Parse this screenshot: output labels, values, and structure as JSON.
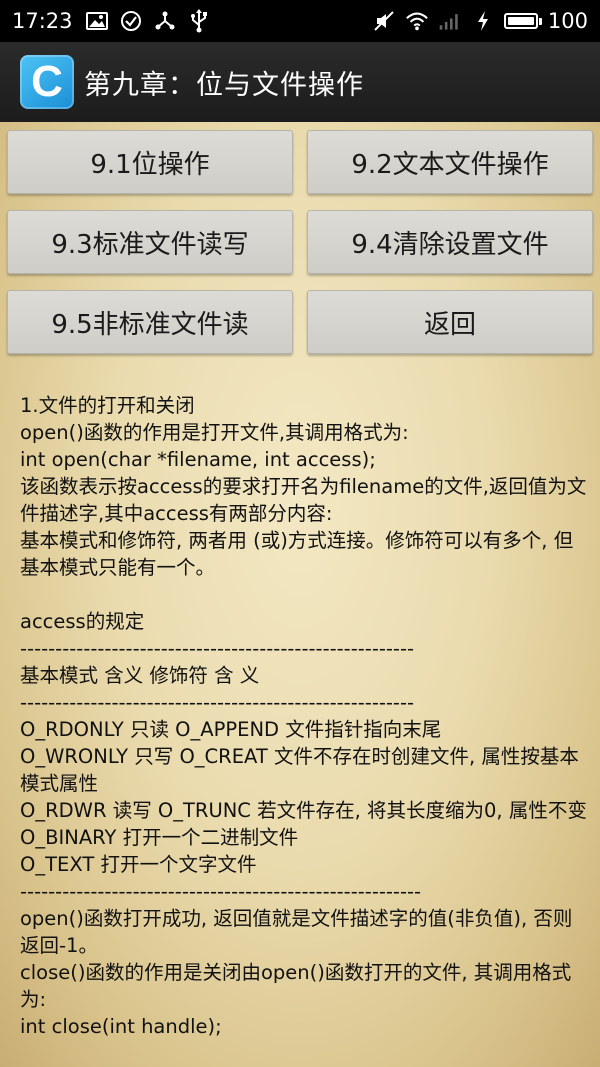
{
  "status_bar": {
    "time": "17:23",
    "battery_level": "100",
    "battery_fraction": 1.0,
    "left_icons": [
      "image-icon",
      "check-circle-icon",
      "share-nodes-icon",
      "usb-icon"
    ],
    "right_icons": [
      "mute-icon",
      "wifi-icon",
      "signal-icon",
      "charging-icon"
    ]
  },
  "app_bar": {
    "logo_letter": "C",
    "title": "第九章：位与文件操作"
  },
  "buttons": [
    {
      "label": "9.1位操作"
    },
    {
      "label": "9.2文本文件操作"
    },
    {
      "label": "9.3标准文件读写"
    },
    {
      "label": "9.4清除设置文件"
    },
    {
      "label": "9.5非标准文件读"
    },
    {
      "label": "返回"
    }
  ],
  "body_text": "1.文件的打开和关闭\nopen()函数的作用是打开文件,其调用格式为:\nint open(char *filename, int access);\n该函数表示按access的要求打开名为filename的文件,返回值为文件描述字,其中access有两部分内容:\n基本模式和修饰符, 两者用 (或)方式连接。修饰符可以有多个, 但基本模式只能有一个。\n\naccess的规定\n--------------------------------------------------------\n基本模式 含义 修饰符 含 义\n--------------------------------------------------------\nO_RDONLY 只读 O_APPEND 文件指针指向末尾\nO_WRONLY 只写 O_CREAT 文件不存在时创建文件, 属性按基本模式属性\nO_RDWR 读写 O_TRUNC 若文件存在, 将其长度缩为0, 属性不变\nO_BINARY 打开一个二进制文件\nO_TEXT 打开一个文字文件\n---------------------------------------------------------\nopen()函数打开成功, 返回值就是文件描述字的值(非负值), 否则返回-1。\nclose()函数的作用是关闭由open()函数打开的文件, 其调用格式为:\nint close(int handle);"
}
